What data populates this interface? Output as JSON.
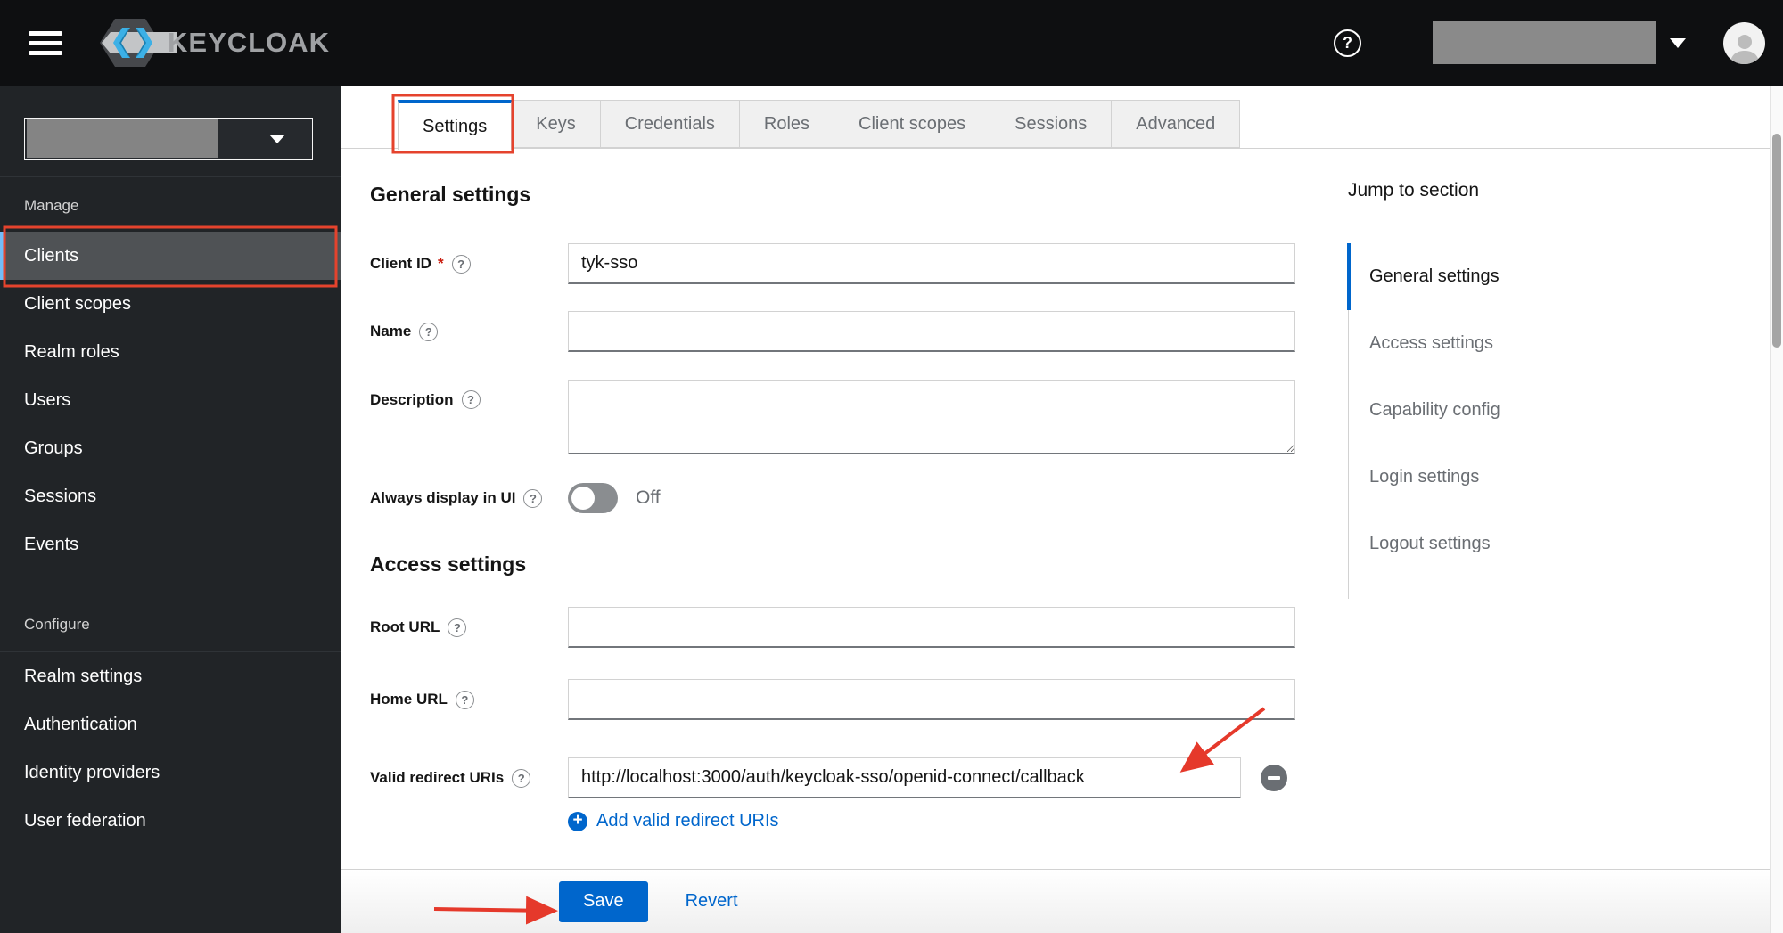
{
  "colors": {
    "accent_blue": "#0066cc",
    "sidebar_active_bar": "#73bcf7",
    "annotation_red": "#e5432d",
    "header_bg": "#0e0f11",
    "sidebar_bg": "#212427"
  },
  "header": {
    "brand": "KEYCLOAK",
    "menu_icon": "hamburger-icon",
    "help_icon": "question-circle-icon",
    "user_menu_caret": "chevron-down-icon",
    "avatar_icon": "user-avatar-icon"
  },
  "sidebar": {
    "realm_selector": {
      "caret_icon": "chevron-down-icon"
    },
    "groups": [
      {
        "label": "Manage",
        "items": [
          {
            "label": "Clients",
            "active": true
          },
          {
            "label": "Client scopes"
          },
          {
            "label": "Realm roles"
          },
          {
            "label": "Users"
          },
          {
            "label": "Groups"
          },
          {
            "label": "Sessions"
          },
          {
            "label": "Events"
          }
        ]
      },
      {
        "label": "Configure",
        "items": [
          {
            "label": "Realm settings"
          },
          {
            "label": "Authentication"
          },
          {
            "label": "Identity providers"
          },
          {
            "label": "User federation"
          }
        ]
      }
    ]
  },
  "tabs": [
    {
      "label": "Settings",
      "active": true
    },
    {
      "label": "Keys"
    },
    {
      "label": "Credentials"
    },
    {
      "label": "Roles"
    },
    {
      "label": "Client scopes"
    },
    {
      "label": "Sessions"
    },
    {
      "label": "Advanced"
    }
  ],
  "form": {
    "general": {
      "title": "General settings",
      "client_id": {
        "label": "Client ID",
        "required": "*",
        "value": "tyk-sso"
      },
      "name": {
        "label": "Name",
        "value": ""
      },
      "description": {
        "label": "Description",
        "value": ""
      },
      "always_display": {
        "label": "Always display in UI",
        "state_label": "Off"
      }
    },
    "access": {
      "title": "Access settings",
      "root_url": {
        "label": "Root URL",
        "value": ""
      },
      "home_url": {
        "label": "Home URL",
        "value": ""
      },
      "valid_redirect_uris": {
        "label": "Valid redirect URIs",
        "value": "http://localhost:3000/auth/keycloak-sso/openid-connect/callback",
        "remove_icon": "minus-circle-icon",
        "add_icon": "plus-circle-icon",
        "add_label": "Add valid redirect URIs"
      }
    }
  },
  "jump_nav": {
    "title": "Jump to section",
    "items": [
      {
        "label": "General settings",
        "active": true
      },
      {
        "label": "Access settings"
      },
      {
        "label": "Capability config"
      },
      {
        "label": "Login settings"
      },
      {
        "label": "Logout settings"
      }
    ]
  },
  "footer": {
    "save_label": "Save",
    "revert_label": "Revert"
  }
}
